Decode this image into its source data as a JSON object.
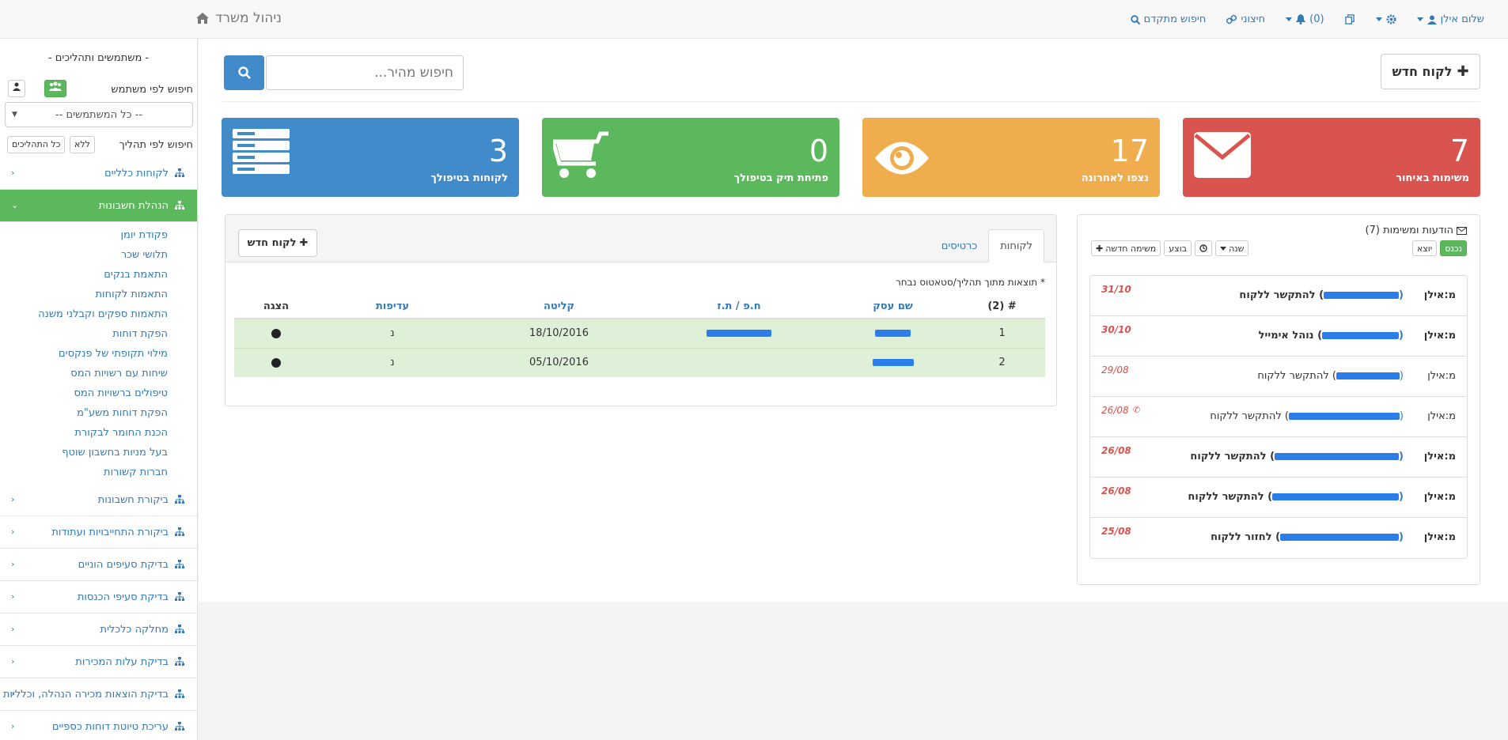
{
  "navbar": {
    "brand": "ניהול משרד",
    "user": "שלום אילן",
    "notifications": "(0)",
    "links": "חיצוני",
    "advanced_search": "חיפוש מתקדם"
  },
  "sidebar": {
    "title": "- משתמשים ותהליכים -",
    "search_user_label": "חיפוש לפי משתמש",
    "users_select": "-- כל המשתמשים --",
    "search_process_label": "חיפוש לפי תהליך",
    "btn_none": "ללא",
    "btn_all": "כל התהליכים",
    "menu": [
      {
        "label": "לקוחות כלליים",
        "active": false
      },
      {
        "label": "הנהלת חשבונות",
        "active": true,
        "sub": [
          "פקודת יומן",
          "תלושי שכר",
          "התאמת בנקים",
          "התאמות לקוחות",
          "התאמות ספקים וקבלני משנה",
          "הפקת דוחות",
          "מילוי תקופתי של פנקסים",
          "שיחות עם רשויות המס",
          "טיפולים ברשויות המס",
          "הפקת דוחות משע\"מ",
          "הכנת החומר לבקורת",
          "בעל מניות בחשבון שוטף",
          "חברות קשורות"
        ]
      },
      {
        "label": "ביקורת חשבונות",
        "active": false
      },
      {
        "label": "ביקורת התחייבויות ועתודות",
        "active": false
      },
      {
        "label": "בדיקת סעיפים הוניים",
        "active": false
      },
      {
        "label": "בדיקת סעיפי הכנסות",
        "active": false
      },
      {
        "label": "מחלקה כלכלית",
        "active": false
      },
      {
        "label": "בדיקת עלות המכירות",
        "active": false
      },
      {
        "label": "בדיקת הוצאות מכירה הנהלה, וכלליות",
        "active": false
      },
      {
        "label": "עריכת טיוטת דוחות כספיים",
        "active": false
      }
    ]
  },
  "toolbar": {
    "new_client": "לקוח חדש",
    "search_placeholder": "חיפוש מהיר..."
  },
  "stats": [
    {
      "num": "7",
      "label": "משימות באיחור",
      "color": "#d9534f",
      "icon": "envelope-icon"
    },
    {
      "num": "17",
      "label": "נצפו לאחרונה",
      "color": "#f0ad4e",
      "icon": "eye-icon"
    },
    {
      "num": "0",
      "label": "פתיחת תיק בטיפולך",
      "color": "#5cb85c",
      "icon": "cart-icon"
    },
    {
      "num": "3",
      "label": "לקוחות בטיפולך",
      "color": "#428bca",
      "icon": "server-icon"
    }
  ],
  "messages": {
    "title": "הודעות ומשימות (7)",
    "btn_in": "נכנס",
    "btn_out": "יוצא",
    "btn_new_task": "משימה חדשה",
    "btn_done": "בוצע",
    "btn_year": "שנה",
    "items": [
      {
        "from": "מ:אילן",
        "text": ") להתקשר ללקוח",
        "date": "31/10",
        "bold": true,
        "phone": false
      },
      {
        "from": "מ:אילן",
        "text": ") נוהל אימייל",
        "date": "30/10",
        "bold": true,
        "phone": false
      },
      {
        "from": "מ:אילן",
        "text": ") להתקשר ללקוח",
        "date": "29/08",
        "bold": false,
        "phone": false
      },
      {
        "from": "מ:אילן",
        "text": ") להתקשר ללקוח",
        "date": "26/08",
        "bold": false,
        "phone": true
      },
      {
        "from": "מ:אילן",
        "text": ") להתקשר ללקוח",
        "date": "26/08",
        "bold": true,
        "phone": false
      },
      {
        "from": "מ:אילן",
        "text": ") להתקשר ללקוח",
        "date": "26/08",
        "bold": true,
        "phone": false
      },
      {
        "from": "מ:אילן",
        "text": ") לחזור ללקוח",
        "date": "25/08",
        "bold": true,
        "phone": false
      }
    ]
  },
  "clients": {
    "tab_clients": "לקוחות",
    "tab_cards": "כרטיסים",
    "new_client": "לקוח חדש",
    "note": "* תוצאות מתוך תהליך/סטאטוס נבחר",
    "headers": [
      "# (2)",
      "שם עסק",
      "ח.פ / ת.ז",
      "קליטה",
      "עדיפות",
      "הצגה"
    ],
    "rows": [
      {
        "num": "1",
        "date": "18/10/2016",
        "priority": "נ"
      },
      {
        "num": "2",
        "date": "05/10/2016",
        "priority": "נ"
      }
    ]
  }
}
